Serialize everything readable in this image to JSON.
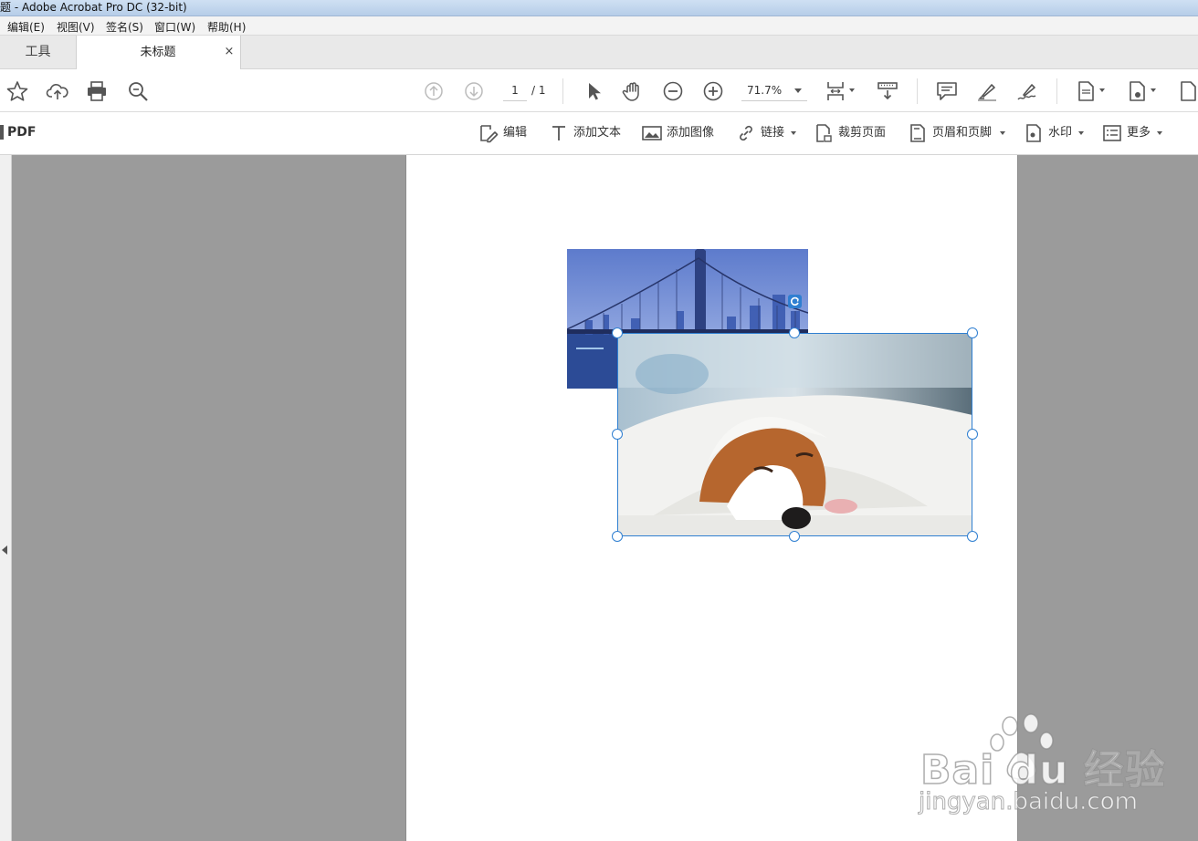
{
  "window": {
    "title": "题 - Adobe Acrobat Pro DC (32-bit)"
  },
  "menu": [
    {
      "label": "编辑(E)"
    },
    {
      "label": "视图(V)"
    },
    {
      "label": "签名(S)"
    },
    {
      "label": "窗口(W)"
    },
    {
      "label": "帮助(H)"
    }
  ],
  "tabs": {
    "tools": "工具",
    "document": "未标题",
    "close": "×"
  },
  "toolbar": {
    "page_current": "1",
    "page_total": "/ 1",
    "zoom": "71.7%",
    "icons": [
      "star-icon",
      "cloud-upload-icon",
      "print-icon",
      "search-zoom-icon",
      "page-up-icon",
      "page-down-icon",
      "select-cursor-icon",
      "hand-tool-icon",
      "zoom-out-icon",
      "zoom-in-icon",
      "page-fit-icon",
      "scroll-mode-icon",
      "comment-icon",
      "highlight-icon",
      "sign-icon",
      "file-icon"
    ]
  },
  "edit_toolbar": {
    "title": "PDF",
    "items": [
      {
        "label": "编辑",
        "icon": "edit-icon"
      },
      {
        "label": "添加文本",
        "icon": "add-text-icon"
      },
      {
        "label": "添加图像",
        "icon": "add-image-icon"
      },
      {
        "label": "链接",
        "icon": "link-icon"
      },
      {
        "label": "裁剪页面",
        "icon": "crop-page-icon"
      },
      {
        "label": "页眉和页脚",
        "icon": "header-footer-icon"
      },
      {
        "label": "水印",
        "icon": "watermark-icon"
      },
      {
        "label": "更多",
        "icon": "more-icon"
      }
    ]
  },
  "watermark": {
    "logo": "Bai  du 经验",
    "sub": "jingyan.baidu.com"
  },
  "colors": {
    "accent": "#2f7fd1",
    "canvas": "#9b9b9b",
    "icon": "#555555"
  }
}
